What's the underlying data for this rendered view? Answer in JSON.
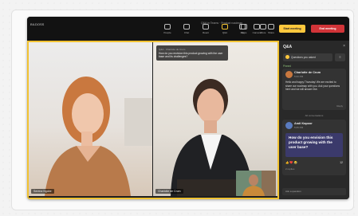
{
  "window": {
    "app_name": "BILDOSS",
    "meeting_title": "Q&A in Teams · Product roadmap"
  },
  "toolbar": {
    "buttons": [
      {
        "label": "People",
        "icon": "people-icon"
      },
      {
        "label": "Chat",
        "icon": "chat-icon"
      },
      {
        "label": "React",
        "icon": "react-icon"
      },
      {
        "label": "Q&A",
        "icon": "qa-icon"
      },
      {
        "label": "Apps",
        "icon": "apps-icon"
      },
      {
        "label": "More",
        "icon": "more-icon"
      }
    ],
    "media": [
      {
        "label": "Mic",
        "icon": "mic-icon"
      },
      {
        "label": "Camera",
        "icon": "camera-icon"
      },
      {
        "label": "Share",
        "icon": "share-icon"
      }
    ],
    "start_label": "Start meeting",
    "end_label": "End meeting"
  },
  "stage": {
    "participant1_name": "Serena Ngobe",
    "participant2_name": "Charlotte de Crum",
    "question_banner": {
      "heading": "Q&A · Charlotte de Crum",
      "text": "How do you envision this product growing with the user base and its challenges?"
    }
  },
  "panel": {
    "title": "Q&A",
    "close": "×",
    "select_label": "Questions you asked",
    "filter": "≡",
    "pinned_label": "Pinned",
    "card1": {
      "name": "Charlotte de Crum",
      "time": "5:00 PM",
      "body": "Hello and happy Thursday! We are excited to share our roadmap with you. Ask your questions here and we will answer live.",
      "reply": "Reply"
    },
    "divider": "All conversations",
    "card2": {
      "name": "Andi Kapoor",
      "time": "5:05 PM",
      "question": "How do you envision this product growing with the user base?",
      "reactions": "👍 ❤️ 😂",
      "count": "12",
      "more": "2 replies"
    },
    "footer": "Ask a question"
  },
  "colors": {
    "accent_yellow": "#f1c232",
    "start_button": "#ffc83d",
    "end_button": "#d13438",
    "panel_bg": "#292929",
    "question_bg": "#3b3a6b"
  }
}
